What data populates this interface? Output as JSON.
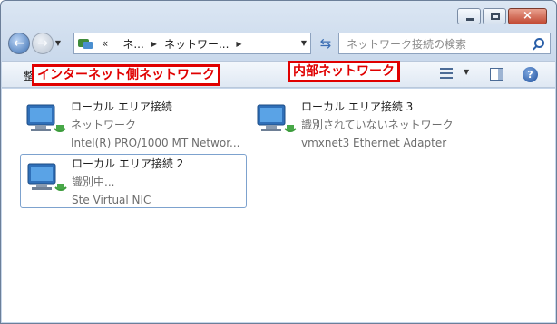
{
  "window": {
    "close_glyph": "×"
  },
  "nav": {
    "breadcrumbs": [
      "«",
      "ネ...",
      "ネットワー..."
    ],
    "search_placeholder": "ネットワーク接続の検索"
  },
  "toolbar": {
    "organize_label": "整",
    "help_label": "?"
  },
  "annotations": {
    "internet_side": "インターネット側ネットワーク",
    "internal": "内部ネットワーク"
  },
  "connections": [
    {
      "name": "ローカル エリア接続",
      "status": "ネットワーク",
      "device": "Intel(R) PRO/1000 MT Networ..."
    },
    {
      "name": "ローカル エリア接続 3",
      "status": "識別されていないネットワーク",
      "device": "vmxnet3 Ethernet Adapter"
    },
    {
      "name": "ローカル エリア接続 2",
      "status": "識別中...",
      "device": "Ste Virtual NIC"
    }
  ],
  "colors": {
    "annotation": "#e00000",
    "selection_border": "#7da2ce"
  }
}
